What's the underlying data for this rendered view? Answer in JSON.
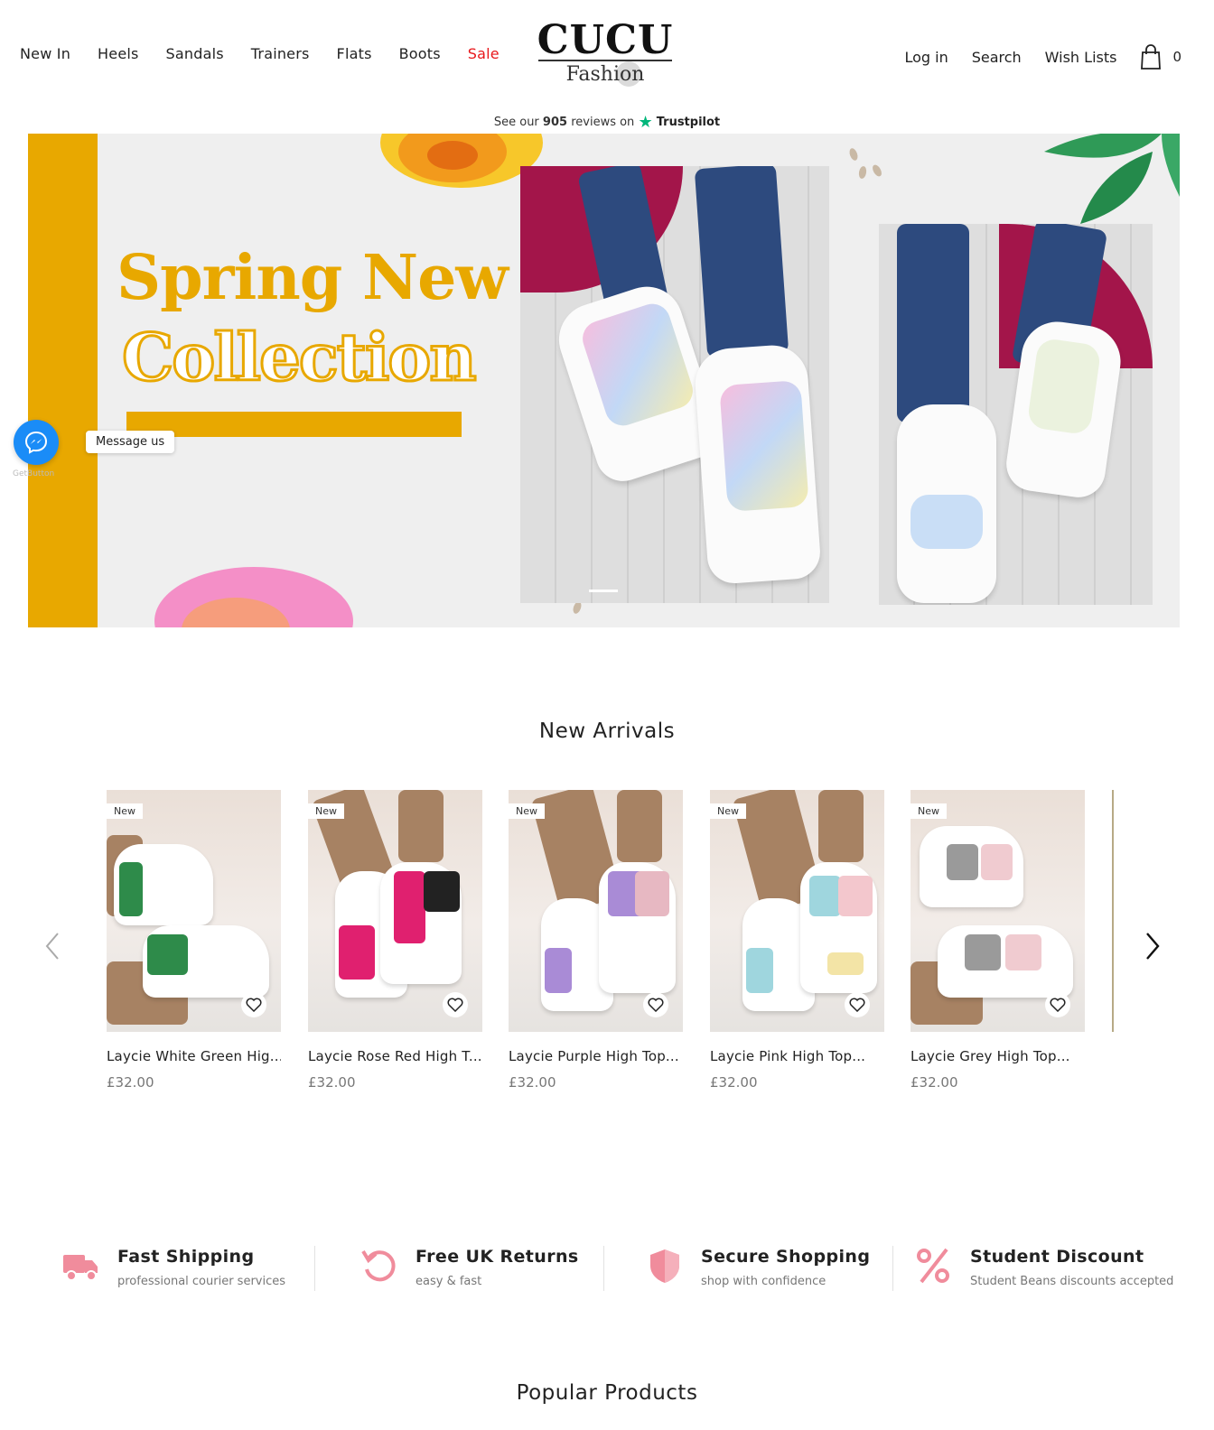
{
  "nav": {
    "left": [
      "New In",
      "Heels",
      "Sandals",
      "Trainers",
      "Flats",
      "Boots",
      "Sale"
    ],
    "right": [
      "Log in",
      "Search",
      "Wish Lists"
    ],
    "cart_count": "0"
  },
  "logo": {
    "title": "CUCU",
    "subtitle": "Fashion"
  },
  "trustpilot": {
    "prefix": "See our",
    "count": "905",
    "middle": "reviews on",
    "brand": "Trustpilot"
  },
  "hero": {
    "line1": "Spring New",
    "line2": "Collection"
  },
  "messenger": {
    "label": "Message us",
    "powered": "GetButton"
  },
  "new_arrivals": {
    "title": "New Arrivals",
    "badge": "New",
    "products": [
      {
        "name": "Laycie White Green Hig...",
        "price": "£32.00",
        "accent": "#2e8b4a"
      },
      {
        "name": "Laycie Rose Red High T...",
        "price": "£32.00",
        "accent": "#e0206f"
      },
      {
        "name": "Laycie Purple High Top...",
        "price": "£32.00",
        "accent": "#a98bd6"
      },
      {
        "name": "Laycie Pink High Top...",
        "price": "£32.00",
        "accent": "#9fd6de"
      },
      {
        "name": "Laycie Grey High Top...",
        "price": "£32.00",
        "accent": "#9a9a9a"
      }
    ]
  },
  "features": [
    {
      "title": "Fast Shipping",
      "sub": "professional courier services",
      "icon": "truck-icon"
    },
    {
      "title": "Free UK Returns",
      "sub": "easy & fast",
      "icon": "return-icon"
    },
    {
      "title": "Secure Shopping",
      "sub": "shop with confidence",
      "icon": "shield-icon"
    },
    {
      "title": "Student Discount",
      "sub": "Student Beans discounts accepted",
      "icon": "percent-icon"
    }
  ],
  "popular": {
    "title": "Popular Products"
  },
  "colors": {
    "accent": "#e8a800",
    "sale": "#e8171b",
    "feature_icon": "#f08c9c",
    "messenger": "#1a8cf7"
  }
}
